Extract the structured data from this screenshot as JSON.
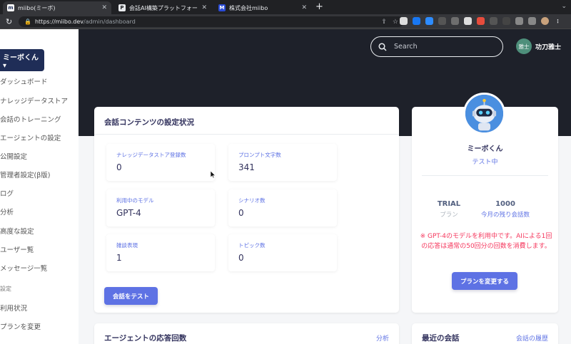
{
  "browser": {
    "tabs": [
      {
        "title": "miibo(ミーボ)",
        "favicon": "m"
      },
      {
        "title": "会話AI構築プラットフォーム「mii",
        "favicon": "P"
      },
      {
        "title": "株式会社miibo",
        "favicon": "M"
      }
    ],
    "new_tab": "+",
    "url_host": "https://miibo.dev",
    "url_path": "/admin/dashboard",
    "chevron": "⌄"
  },
  "sidebar": {
    "bot_button": "ミーボくん ▾",
    "items": [
      "ダッシュボード",
      "ナレッジデータストア",
      "会話のトレーニング",
      "エージェントの設定",
      "公開設定",
      "管理者設定(β版)",
      "ログ",
      "分析",
      "高度な設定",
      "ユーザー覧",
      "メッセージ一覧"
    ],
    "section_label": "設定",
    "settings_items": [
      "利用状況",
      "プランを変更"
    ]
  },
  "header": {
    "search_placeholder": "Search",
    "user_avatar": "雅士",
    "user_name": "功刀雅士"
  },
  "settings_card": {
    "title": "会話コンテンツの設定状況",
    "stats": [
      {
        "label": "ナレッジデータストア登録数",
        "value": "0"
      },
      {
        "label": "プロンプト文字数",
        "value": "341"
      },
      {
        "label": "利用中のモデル",
        "value": "GPT-4"
      },
      {
        "label": "シナリオ数",
        "value": "0"
      },
      {
        "label": "雑談表現",
        "value": "1"
      },
      {
        "label": "トピック数",
        "value": "0"
      }
    ],
    "test_button": "会話をテスト"
  },
  "plan_card": {
    "bot_name": "ミーボくん",
    "status": "テスト中",
    "plan_value": "TRIAL",
    "plan_label": "プラン",
    "remaining_value": "1000",
    "remaining_label": "今月の残り会話数",
    "warning": "※ GPT-4のモデルを利用中です。AIによる1回の応答は通常の50回分の回数を消費します。",
    "change_button": "プランを変更する"
  },
  "response_card": {
    "title": "エージェントの応答回数",
    "link": "分析"
  },
  "recent_card": {
    "title": "最近の会話",
    "link": "会話の履歴"
  },
  "colors": {
    "accent": "#5e72e4",
    "dark": "#1e212a",
    "warning": "#f5365c",
    "navy": "#1f2d57"
  }
}
